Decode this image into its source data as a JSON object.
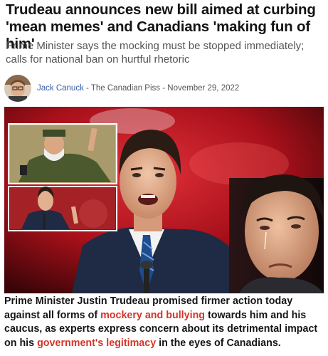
{
  "article": {
    "headline": "Trudeau announces new bill aimed at curbing 'mean memes' and Canadians 'making fun of him'",
    "subheadline": "Prime Minister says the mocking must be stopped immediately; calls for national ban on hurtful rhetoric",
    "byline": {
      "author": "Jack Canuck",
      "separator_1": " - ",
      "publication": "The Canadian Piss",
      "separator_2": " - ",
      "date": "November 29, 2022"
    },
    "caption": {
      "part1": "Prime Minister Justin Trudeau promised firmer action today against all forms of ",
      "highlight1": "mockery and bullying",
      "part2": " towards him and his caucus, as experts express concern about its detrimental impact on his ",
      "highlight2": "government's legitimacy",
      "part3": " in the eyes of Canadians."
    },
    "colors": {
      "highlight": "#d3352a",
      "author_link": "#3a62a8",
      "background_red": "#a8101a"
    }
  }
}
